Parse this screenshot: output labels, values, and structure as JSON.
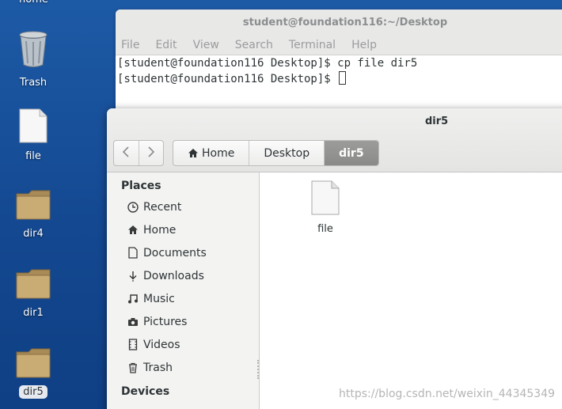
{
  "desktop": {
    "cut_label": "home",
    "items": [
      {
        "label": "Trash",
        "icon": "trash-icon"
      },
      {
        "label": "file",
        "icon": "file-icon"
      },
      {
        "label": "dir4",
        "icon": "folder-icon"
      },
      {
        "label": "dir1",
        "icon": "folder-icon"
      },
      {
        "label": "dir5",
        "icon": "folder-icon"
      }
    ]
  },
  "terminal": {
    "title": "student@foundation116:~/Desktop",
    "menu": [
      "File",
      "Edit",
      "View",
      "Search",
      "Terminal",
      "Help"
    ],
    "lines": [
      "[student@foundation116 Desktop]$ cp file dir5",
      "[student@foundation116 Desktop]$ "
    ]
  },
  "file_manager": {
    "title": "dir5",
    "back_icon": "chevron-left-icon",
    "forward_icon": "chevron-right-icon",
    "breadcrumb": [
      {
        "label": "Home",
        "icon": "home-icon"
      },
      {
        "label": "Desktop"
      },
      {
        "label": "dir5"
      }
    ],
    "sidebar": {
      "places_heading": "Places",
      "items": [
        {
          "label": "Recent",
          "icon": "clock-icon"
        },
        {
          "label": "Home",
          "icon": "home-icon"
        },
        {
          "label": "Documents",
          "icon": "document-icon"
        },
        {
          "label": "Downloads",
          "icon": "download-icon"
        },
        {
          "label": "Music",
          "icon": "music-icon"
        },
        {
          "label": "Pictures",
          "icon": "camera-icon"
        },
        {
          "label": "Videos",
          "icon": "film-icon"
        },
        {
          "label": "Trash",
          "icon": "trash-icon"
        }
      ],
      "devices_heading": "Devices"
    },
    "files": [
      {
        "name": "file",
        "icon": "file-icon"
      }
    ]
  },
  "watermark": "https://blog.csdn.net/weixin_44345349",
  "colors": {
    "desktop_bg": "#1d5aa6",
    "selection_bg": "#e6e9ee",
    "active_crumb": "#8a8a89"
  }
}
